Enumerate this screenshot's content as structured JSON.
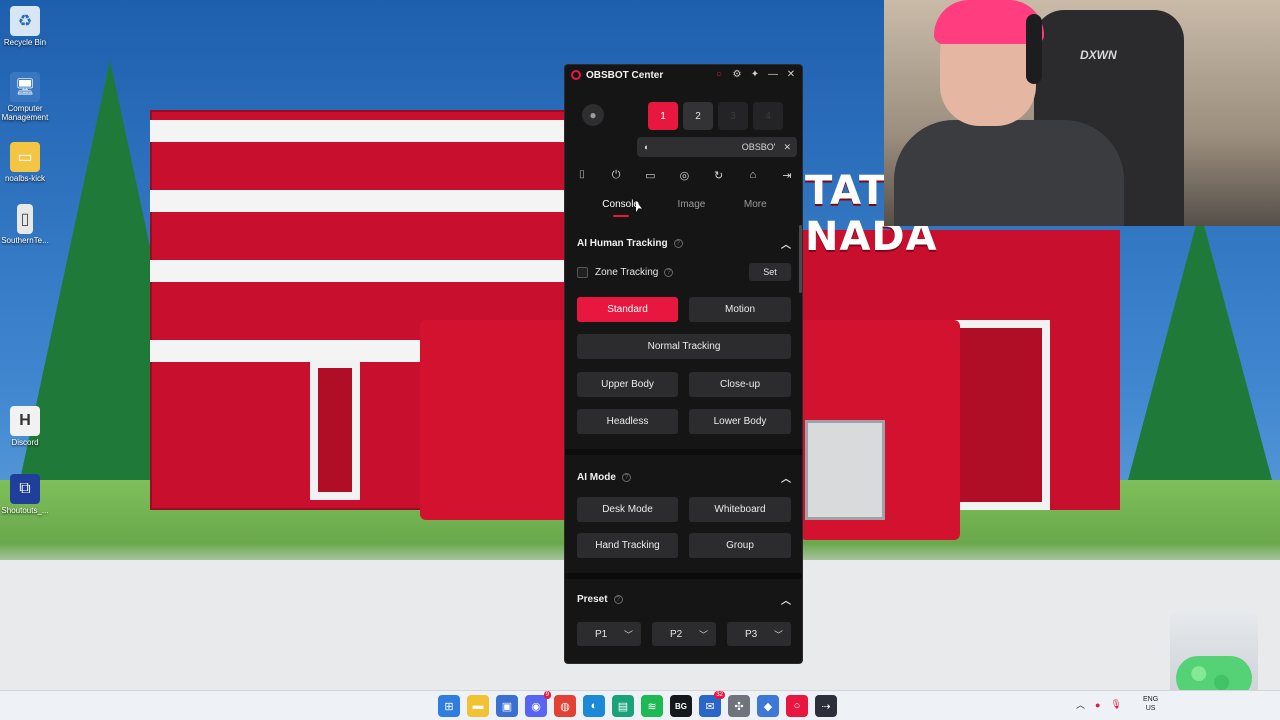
{
  "desktop": {
    "icons": [
      {
        "label": "Recycle Bin",
        "icon": "recycle-bin-icon"
      },
      {
        "label": "Computer Management",
        "icon": "computer-icon"
      },
      {
        "label": "noalbs-kick",
        "icon": "folder-icon"
      },
      {
        "label": "SouthernTe...",
        "icon": "file-icon"
      },
      {
        "label": "Discord",
        "icon": "discord-icon"
      },
      {
        "label": "Shoutouts_...",
        "icon": "shortcut-icon"
      }
    ],
    "wallpaper_sign": "TATIC\nNADA"
  },
  "webcam": {
    "chair_logo": "DXWN"
  },
  "obsbot": {
    "title": "OBSBOT Center",
    "accent": "#e8173f",
    "camera_slots": [
      {
        "label": "1",
        "state": "active"
      },
      {
        "label": "2",
        "state": "normal"
      },
      {
        "label": "3",
        "state": "disabled"
      },
      {
        "label": "4",
        "state": "disabled"
      }
    ],
    "device_name": "OBSBO'",
    "tabs": [
      {
        "label": "Console",
        "active": true
      },
      {
        "label": "Image",
        "active": false
      },
      {
        "label": "More",
        "active": false
      }
    ],
    "ai_tracking": {
      "title": "AI Human Tracking",
      "zone_tracking_label": "Zone Tracking",
      "zone_tracking_checked": false,
      "set_label": "Set",
      "standard": "Standard",
      "motion": "Motion",
      "normal_tracking": "Normal Tracking",
      "upper_body": "Upper Body",
      "close_up": "Close-up",
      "headless": "Headless",
      "lower_body": "Lower Body"
    },
    "ai_mode": {
      "title": "AI Mode",
      "desk_mode": "Desk Mode",
      "whiteboard": "Whiteboard",
      "hand_tracking": "Hand Tracking",
      "group": "Group"
    },
    "preset": {
      "title": "Preset",
      "items": [
        "P1",
        "P2",
        "P3"
      ]
    }
  },
  "taskbar": {
    "apps": [
      "windows-start-icon",
      "file-explorer-icon",
      "store-icon",
      "discord-icon",
      "chrome-icon",
      "edge-icon",
      "app-icon",
      "spotify-icon",
      "bg-icon",
      "mail-icon",
      "tool-icon",
      "app2-icon",
      "obsbot-icon",
      "arrow-app-icon"
    ],
    "discord_badge": "9",
    "mail_badge": "32",
    "bg_label": "BG",
    "lang_line1": "ENG",
    "lang_line2": "US"
  }
}
